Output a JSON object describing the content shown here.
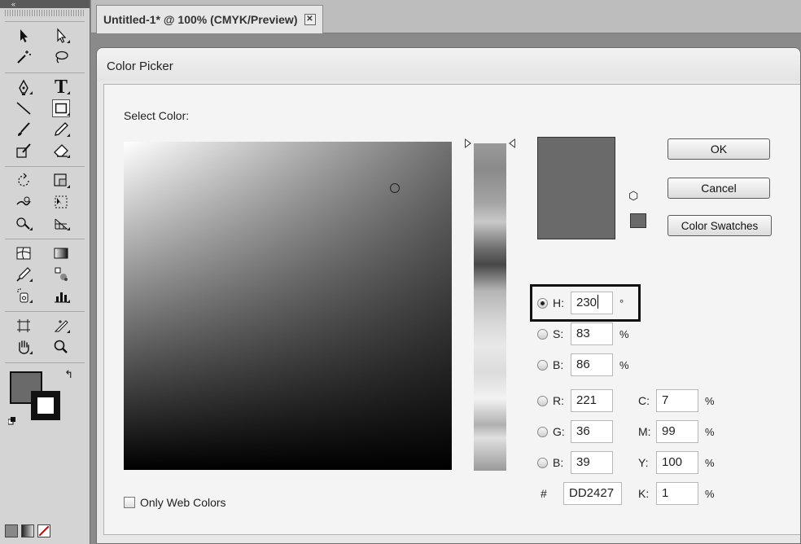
{
  "toolbar": {
    "collapse_glyph": "«",
    "tools": [
      [
        "selection-tool",
        "direct-selection-tool"
      ],
      [
        "magic-wand-tool",
        "lasso-tool"
      ],
      [
        "pen-tool",
        "type-tool"
      ],
      [
        "line-segment-tool",
        "rectangle-tool"
      ],
      [
        "paintbrush-tool",
        "pencil-tool"
      ],
      [
        "blob-brush-tool",
        "eraser-tool"
      ],
      [
        "rotate-tool",
        "scale-tool"
      ],
      [
        "warp-tool",
        "free-transform-tool"
      ],
      [
        "shape-builder-tool",
        "perspective-grid-tool"
      ],
      [
        "mesh-tool",
        "gradient-tool"
      ],
      [
        "eyedropper-tool",
        "blend-tool"
      ],
      [
        "symbol-sprayer-tool",
        "column-graph-tool"
      ],
      [
        "artboard-tool",
        "slice-tool"
      ],
      [
        "hand-tool",
        "zoom-tool"
      ]
    ],
    "type_glyph": "T",
    "swap_glyph": "↰",
    "fill_color": "#6a6a6a"
  },
  "document": {
    "tab_title": "Untitled-1* @ 100% (CMYK/Preview)",
    "close_glyph": "✕"
  },
  "dialog": {
    "title": "Color Picker",
    "select_label": "Select Color:",
    "buttons": {
      "ok": "OK",
      "cancel": "Cancel",
      "swatches": "Color Swatches"
    },
    "preview_color": "#6a6a6a",
    "gamut_glyph": "⬡",
    "hsb": [
      {
        "label": "H:",
        "value": "230",
        "unit": "°",
        "checked": true
      },
      {
        "label": "S:",
        "value": "83",
        "unit": "%",
        "checked": false
      },
      {
        "label": "B:",
        "value": "86",
        "unit": "%",
        "checked": false
      }
    ],
    "rgb": [
      {
        "label": "R:",
        "value": "221"
      },
      {
        "label": "G:",
        "value": "36"
      },
      {
        "label": "B:",
        "value": "39"
      }
    ],
    "cmyk": [
      {
        "label": "C:",
        "value": "7",
        "unit": "%"
      },
      {
        "label": "M:",
        "value": "99",
        "unit": "%"
      },
      {
        "label": "Y:",
        "value": "100",
        "unit": "%"
      },
      {
        "label": "K:",
        "value": "1",
        "unit": "%"
      }
    ],
    "hex": {
      "label": "#",
      "value": "DD2427"
    },
    "web_colors": {
      "label": "Only Web Colors",
      "checked": false
    }
  }
}
